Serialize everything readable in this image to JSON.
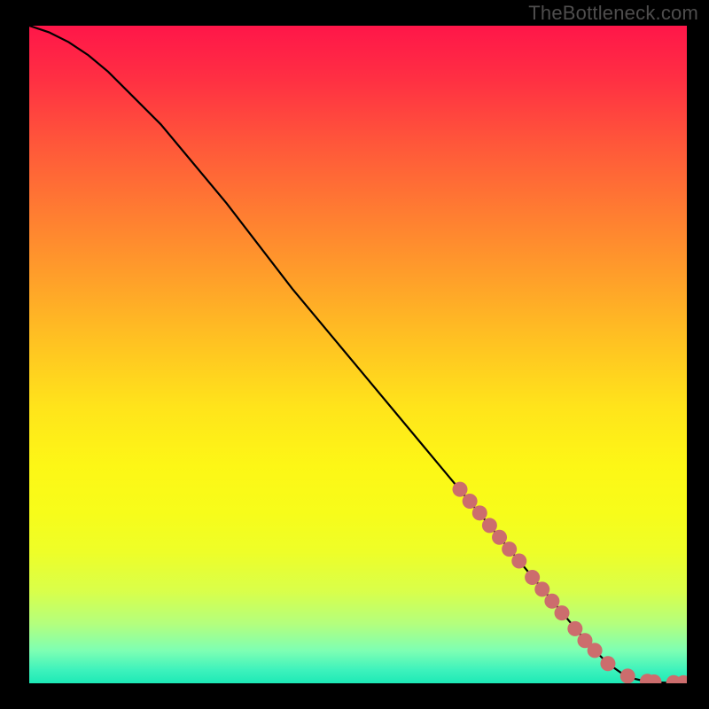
{
  "attribution": "TheBottleneck.com",
  "chart_data": {
    "type": "line",
    "title": "",
    "xlabel": "",
    "ylabel": "",
    "xlim": [
      0,
      100
    ],
    "ylim": [
      0,
      100
    ],
    "series": [
      {
        "name": "curve",
        "x": [
          0,
          3,
          6,
          9,
          12,
          15,
          20,
          30,
          40,
          50,
          60,
          70,
          80,
          85,
          88,
          90,
          92,
          94,
          95,
          97,
          100
        ],
        "y": [
          100,
          99,
          97.5,
          95.5,
          93,
          90,
          85,
          73,
          60,
          48,
          36,
          24,
          12,
          6,
          3,
          1.6,
          0.7,
          0.25,
          0.15,
          0.08,
          0.05
        ]
      }
    ],
    "markers": {
      "name": "highlighted-points",
      "color": "#cc6d6d",
      "points": [
        {
          "x": 65.5,
          "y": 29.5
        },
        {
          "x": 67.0,
          "y": 27.7
        },
        {
          "x": 68.5,
          "y": 25.9
        },
        {
          "x": 70.0,
          "y": 24.0
        },
        {
          "x": 71.5,
          "y": 22.2
        },
        {
          "x": 73.0,
          "y": 20.4
        },
        {
          "x": 74.5,
          "y": 18.6
        },
        {
          "x": 76.5,
          "y": 16.1
        },
        {
          "x": 78.0,
          "y": 14.3
        },
        {
          "x": 79.5,
          "y": 12.5
        },
        {
          "x": 81.0,
          "y": 10.7
        },
        {
          "x": 83.0,
          "y": 8.3
        },
        {
          "x": 84.5,
          "y": 6.5
        },
        {
          "x": 86.0,
          "y": 5.0
        },
        {
          "x": 88.0,
          "y": 3.0
        },
        {
          "x": 91.0,
          "y": 1.1
        },
        {
          "x": 94.0,
          "y": 0.3
        },
        {
          "x": 95.0,
          "y": 0.2
        },
        {
          "x": 98.0,
          "y": 0.1
        },
        {
          "x": 99.5,
          "y": 0.08
        }
      ]
    },
    "background": "red-yellow-green vertical gradient"
  }
}
